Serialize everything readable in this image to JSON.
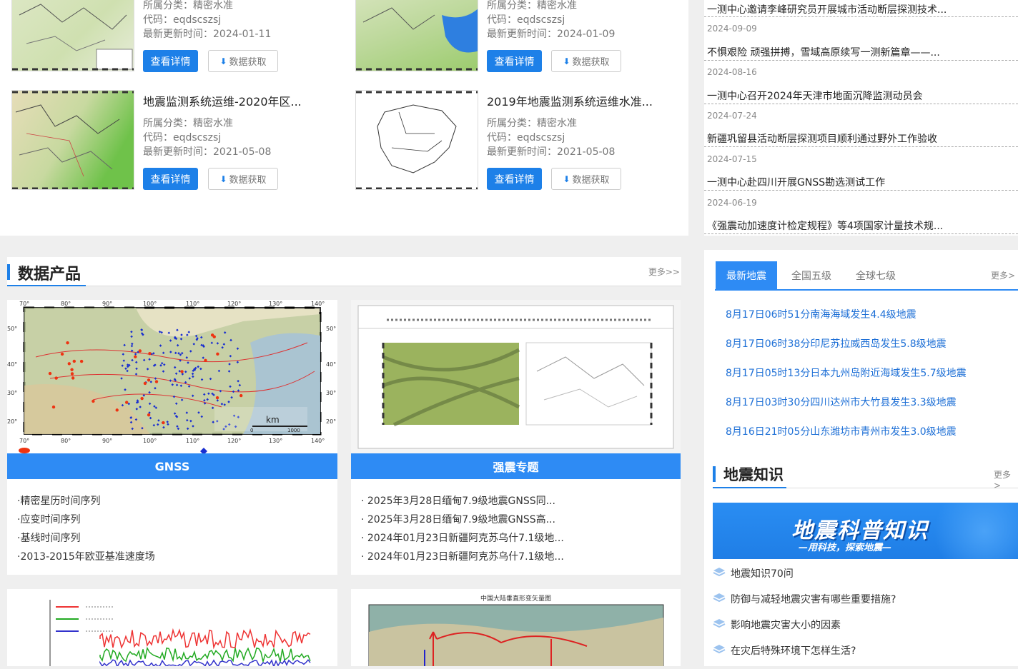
{
  "datasets": [
    {
      "title": "",
      "category": "所属分类：精密水准",
      "code": "代码：eqdscszsj",
      "updated": "最新更新时间：2024-01-11",
      "detail": "查看详情",
      "download": "数据获取"
    },
    {
      "title": "",
      "category": "所属分类：精密水准",
      "code": "代码：eqdscszsj",
      "updated": "最新更新时间：2024-01-09",
      "detail": "查看详情",
      "download": "数据获取"
    },
    {
      "title": "地震监测系统运维-2020年区...",
      "category": "所属分类：精密水准",
      "code": "代码：eqdscszsj",
      "updated": "最新更新时间：2021-05-08",
      "detail": "查看详情",
      "download": "数据获取"
    },
    {
      "title": "2019年地震监测系统运维水准...",
      "category": "所属分类：精密水准",
      "code": "代码：eqdscszsj",
      "updated": "最新更新时间：2021-05-08",
      "detail": "查看详情",
      "download": "数据获取"
    }
  ],
  "news": [
    {
      "title": "一测中心邀请李峰研究员开展城市活动断层探测技术...",
      "date": ""
    },
    {
      "title": "不惧艰险 顽强拼搏，雪域高原续写一测新篇章——...",
      "date": "2024-09-09"
    },
    {
      "title": "一测中心召开2024年天津市地面沉降监测动员会",
      "date": "2024-08-16"
    },
    {
      "title": "新疆巩留县活动断层探测项目顺利通过野外工作验收",
      "date": "2024-07-24"
    },
    {
      "title": "一测中心赴四川开展GNSS勘选测试工作",
      "date": "2024-07-15"
    },
    {
      "title": "《强震动加速度计检定规程》等4项国家计量技术规...",
      "date": "2024-06-19"
    }
  ],
  "products": {
    "title": "数据产品",
    "more": "更多>>",
    "gnss": {
      "label": "GNSS",
      "items": [
        "·精密星历时间序列",
        "·应变时间序列",
        "·基线时间序列",
        "·2013-2015年欧亚基准速度场"
      ],
      "map_scale": "km",
      "scale_zero": "0",
      "scale_end": "1000",
      "lon_ticks": [
        "70°",
        "80°",
        "90°",
        "100°",
        "110°",
        "120°",
        "130°",
        "140°"
      ],
      "lat_ticks": [
        "50°",
        "40°",
        "30°",
        "20°"
      ]
    },
    "quake": {
      "label": "强震专题",
      "items": [
        "· 2025年3月28日缅甸7.9级地震GNSS同...",
        "· 2025年3月28日缅甸7.9级地震GNSS高...",
        "· 2024年01月23日新疆阿克苏乌什7.1级地...",
        "· 2024年01月23日新疆阿克苏乌什7.1级地..."
      ]
    },
    "vector_map_title": "中国大陆垂直形变矢量图"
  },
  "earthquakes": {
    "tabs": [
      "最新地震",
      "全国五级",
      "全球七级"
    ],
    "more": "更多>",
    "items": [
      "8月17日06时51分南海海域发生4.4级地震",
      "8月17日06时38分印尼苏拉威西岛发生5.8级地震",
      "8月17日05时13分日本九州岛附近海域发生5.7级地震",
      "8月17日03时30分四川达州市大竹县发生3.3级地震",
      "8月16日21时05分山东潍坊市青州市发生3.0级地震"
    ]
  },
  "knowledge": {
    "title": "地震知识",
    "more": "更多>",
    "banner_title": "地震科普知识",
    "banner_sub": "—用科技，探索地震—",
    "items": [
      "地震知识70问",
      "防御与减轻地震灾害有哪些重要措施?",
      "影响地震灾害大小的因素",
      "在灾后特殊环境下怎样生活?"
    ]
  },
  "colors": {
    "accent": "#1d80e8",
    "bar": "#2e8bf4",
    "link": "#1d6fd6"
  }
}
